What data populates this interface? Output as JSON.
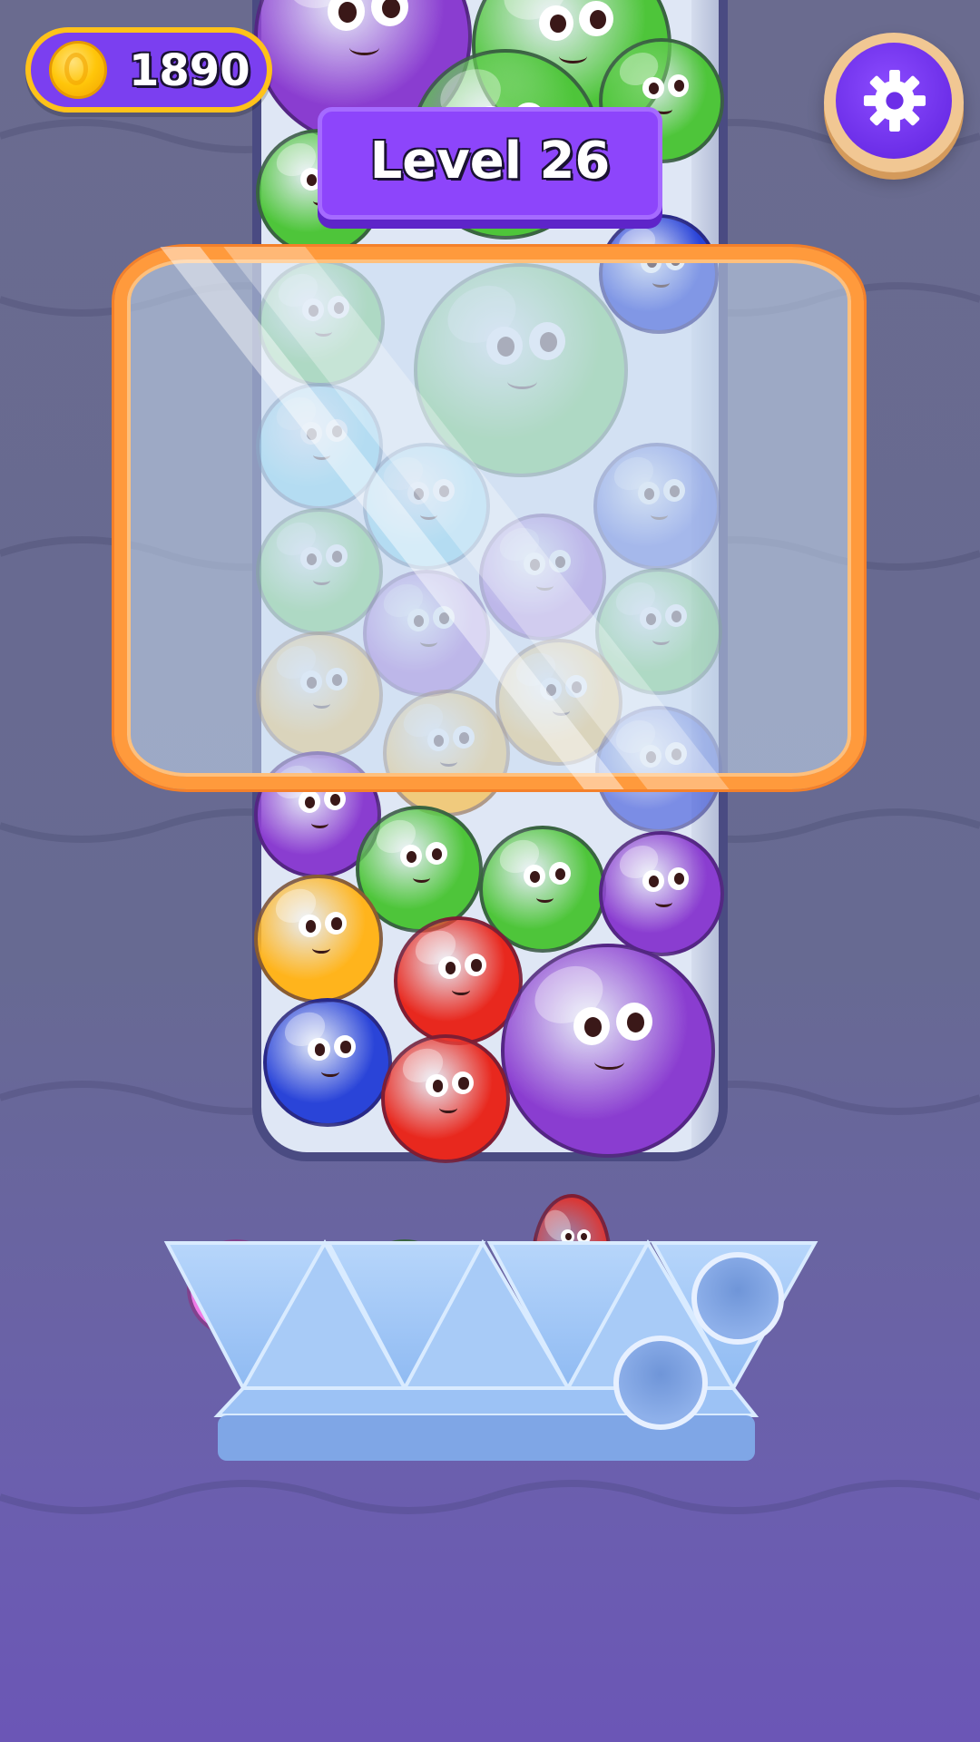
{
  "hud": {
    "coins": "1890",
    "coin_icon": "coin-icon",
    "settings_icon": "gear-icon"
  },
  "level": {
    "label": "Level 26"
  },
  "colors": {
    "green": "#4ec53a",
    "purple": "#8a3dd0",
    "blue": "#2a44d8",
    "lightblue": "#66d4f2",
    "yellow": "#ffb41c",
    "red": "#e8281e",
    "pink": "#f07ae6",
    "glass_frame": "#ff9a3c",
    "tray": "#9cc6f6"
  },
  "tray": {
    "slots": [
      "pink",
      "green",
      "red",
      "empty",
      "blue",
      "purple",
      "empty"
    ]
  }
}
